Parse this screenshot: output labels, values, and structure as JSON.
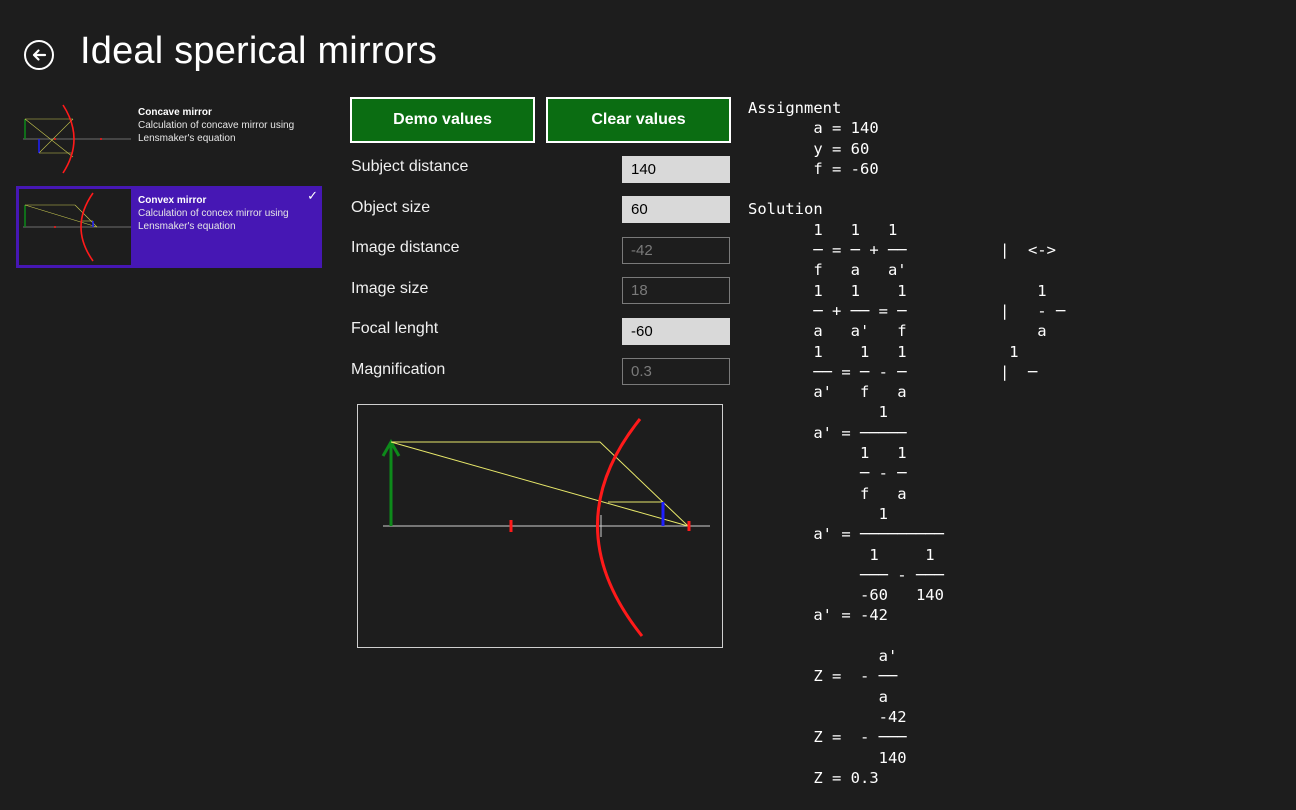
{
  "header": {
    "title": "Ideal sperical mirrors"
  },
  "nav": {
    "items": [
      {
        "name": "Concave mirror",
        "line1": "Calculation of concave mirror using",
        "line2": "Lensmaker's equation",
        "selected": false
      },
      {
        "name": "Convex mirror",
        "line1": "Calculation of concex mirror using",
        "line2": "Lensmaker's equation",
        "selected": true
      }
    ]
  },
  "buttons": {
    "demo": "Demo values",
    "clear": "Clear values"
  },
  "fields": [
    {
      "label": "Subject distance",
      "value": "140",
      "editable": true
    },
    {
      "label": "Object size",
      "value": "60",
      "editable": true
    },
    {
      "label": "Image distance",
      "value": "-42",
      "editable": false
    },
    {
      "label": "Image size",
      "value": "18",
      "editable": false
    },
    {
      "label": "Focal lenght",
      "value": "-60",
      "editable": true
    },
    {
      "label": "Magnification",
      "value": "0.3",
      "editable": false
    }
  ],
  "colors": {
    "accent": "#4617b4",
    "button_bg": "#0b6d12",
    "mirror": "#ff1a1a",
    "object_arrow": "#0d8a1a",
    "image_arrow": "#1f1fff",
    "rays": "#e8e86a",
    "axis": "#cfcfcf"
  },
  "solution_lines": [
    "Assignment",
    "       a = 140",
    "       y = 60",
    "       f = -60",
    "",
    "Solution",
    "       1   1   1",
    "       ─ = ─ + ──          |  <->",
    "       f   a   a'",
    "       1   1    1              1",
    "       ─ + ── = ─          |   - ─",
    "       a   a'   f              a",
    "       1    1   1           1",
    "       ── = ─ - ─          |  ─",
    "       a'   f   a",
    "              1",
    "       a' = ─────",
    "            1   1",
    "            ─ - ─",
    "            f   a",
    "              1",
    "       a' = ─────────",
    "             1     1",
    "            ─── - ───",
    "            -60   140",
    "       a' = -42",
    "",
    "              a'",
    "       Z =  - ──",
    "              a",
    "              -42",
    "       Z =  - ───",
    "              140",
    "       Z = 0.3"
  ]
}
